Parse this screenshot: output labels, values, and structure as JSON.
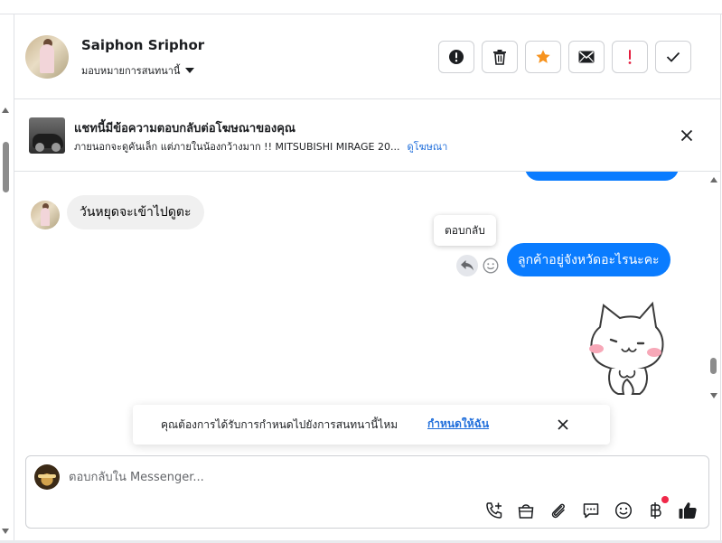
{
  "header": {
    "contact_name": "Saiphon Sriphor",
    "assign_label": "มอบหมายการสนทนานี้",
    "actions": [
      {
        "id": "mark-spam",
        "icon": "exclamation-circle-icon"
      },
      {
        "id": "delete",
        "icon": "trash-icon"
      },
      {
        "id": "star",
        "icon": "star-icon"
      },
      {
        "id": "mark-unread",
        "icon": "envelope-icon"
      },
      {
        "id": "follow-up",
        "icon": "exclamation-mark-icon"
      },
      {
        "id": "mark-done",
        "icon": "checkmark-icon"
      }
    ]
  },
  "ad_banner": {
    "title": "แชทนี้มีข้อความตอบกลับต่อโฆษณาของคุณ",
    "description": "ภายนอกจะดูคันเล็ก แต่ภายในน้องกว้างมาก !! MITSUBISHI MIRAGE 20...",
    "link": "ดูโฆษณา"
  },
  "messages": {
    "incoming_text": "วันหยุดจะเข้าไปดูตะ",
    "tooltip": "ตอบกลับ",
    "outgoing_text": "ลูกค้าอยู่จังหวัดอะไรนะคะ"
  },
  "assign_prompt": {
    "text": "คุณต้องการได้รับการกำหนดไปยังการสนทนานี้ไหม",
    "link": "กำหนดให้ฉัน"
  },
  "composer": {
    "placeholder": "ตอบกลับใน Messenger...",
    "tools": [
      "phone-add-icon",
      "shopping-bag-icon",
      "paperclip-icon",
      "saved-reply-icon",
      "emoji-icon",
      "baht-icon",
      "thumbs-up-icon"
    ]
  },
  "colors": {
    "accent": "#0a7cff",
    "link": "#216fdb",
    "star": "#f7931e",
    "follow_up": "#e41e3f",
    "notification_dot": "#f02849"
  }
}
